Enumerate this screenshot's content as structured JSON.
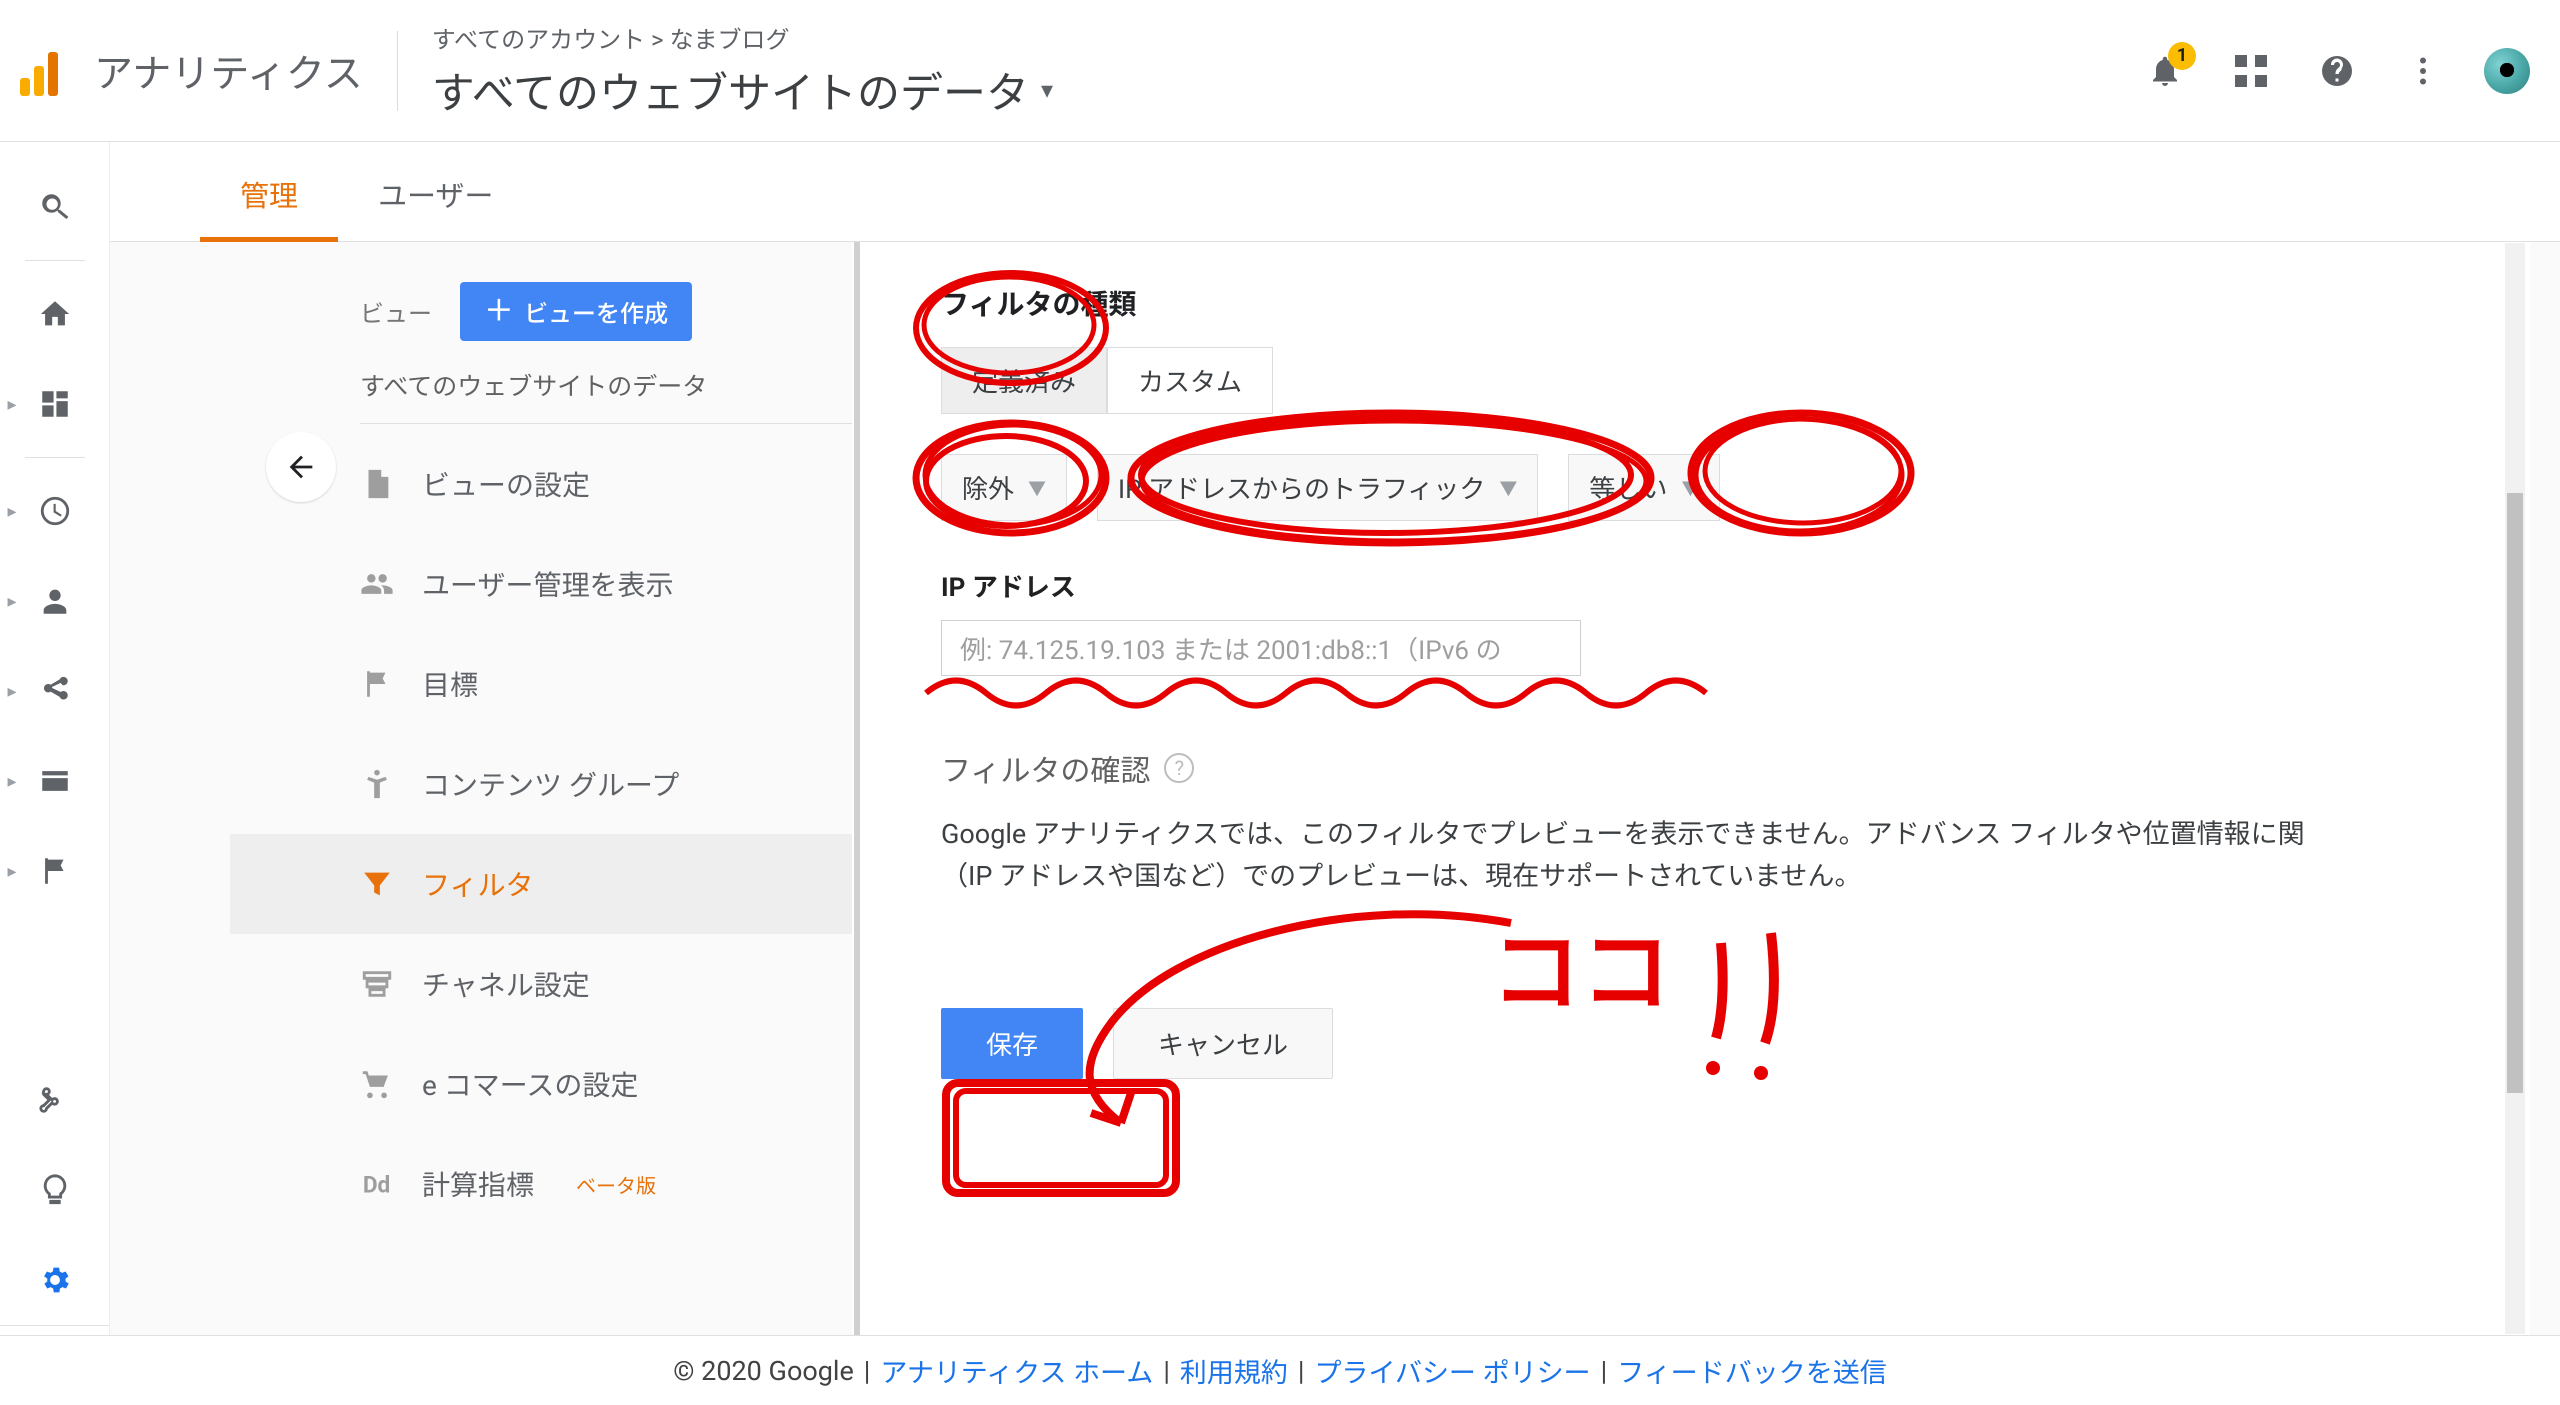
{
  "topbar": {
    "product": "アナリティクス",
    "breadcrumb": "すべてのアカウント > なまブログ",
    "view_name": "すべてのウェブサイトのデータ",
    "notification_count": "1"
  },
  "subtabs": {
    "admin": "管理",
    "user": "ユーザー"
  },
  "view_column": {
    "label": "ビュー",
    "create_label": "ビューを作成",
    "current_view": "すべてのウェブサイトのデータ",
    "items": {
      "settings": "ビューの設定",
      "users": "ユーザー管理を表示",
      "goals": "目標",
      "content_group": "コンテンツ グループ",
      "filter": "フィルタ",
      "channel": "チャネル設定",
      "ecommerce": "e コマースの設定",
      "calc": "計算指標",
      "calc_beta": "ベータ版"
    }
  },
  "filter_form": {
    "type_title": "フィルタの種類",
    "tab_predef": "定義済み",
    "tab_custom": "カスタム",
    "dd_exclude": "除外",
    "dd_traffic": "IP アドレスからのトラフィック",
    "dd_match": "等しい",
    "ip_label": "IP アドレス",
    "ip_placeholder": "例: 74.125.19.103 または 2001:db8::1（IPv6 の",
    "verify_title": "フィルタの確認",
    "verify_msg1": "Google アナリティクスでは、このフィルタでプレビューを表示できません。アドバンス フィルタや位置情報に関",
    "verify_msg2": "（IP アドレスや国など）でのプレビューは、現在サポートされていません。",
    "save": "保存",
    "cancel": "キャンセル"
  },
  "footer": {
    "copyright": "© 2020 Google",
    "home": "アナリティクス ホーム",
    "tos": "利用規約",
    "privacy": "プライバシー ポリシー",
    "feedback": "フィードバックを送信"
  },
  "annotations": {
    "handwritten": "ココ"
  }
}
